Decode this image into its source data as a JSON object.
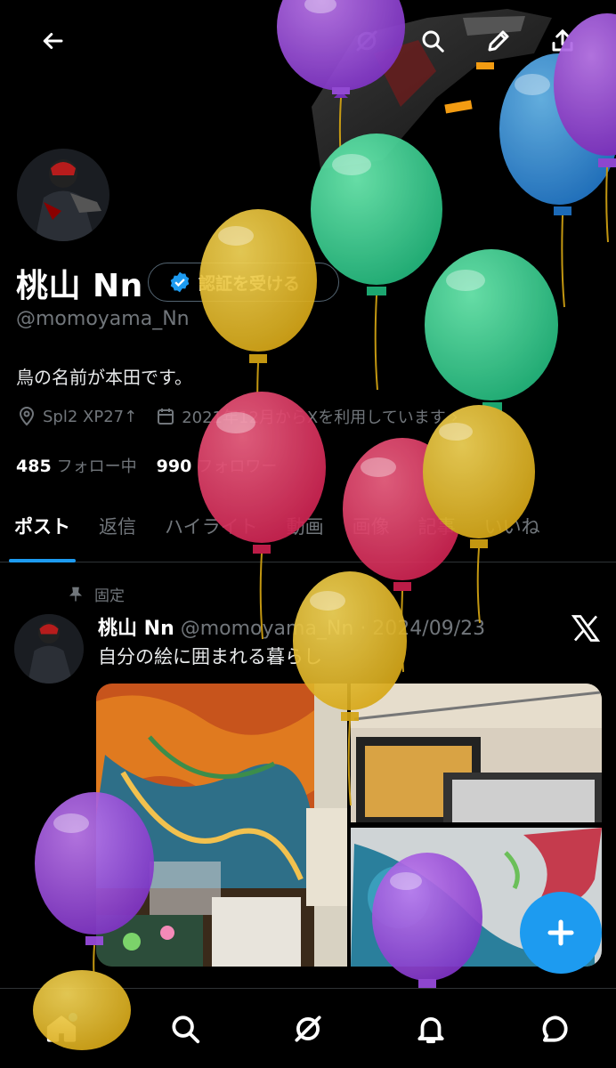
{
  "profile": {
    "name": "桃山 Nn",
    "verify_label": "認証を受ける",
    "handle": "@momoyama_Nn",
    "bio": "鳥の名前が本田です。",
    "location": "Spl2 XP27↑",
    "joined": "2021年12月からXを利用しています",
    "following_count": "485",
    "following_label": "フォロー中",
    "followers_count": "990",
    "followers_label": "フォロワー"
  },
  "tabs": [
    "ポスト",
    "返信",
    "ハイライト",
    "動画",
    "画像",
    "記事",
    "いいね"
  ],
  "post": {
    "pinned_label": "固定",
    "author_name": "桃山 Nn",
    "author_handle_date": "@momoyama_Nn · 2024/09/23",
    "text": "自分の絵に囲まれる暮らし"
  },
  "icons": {
    "back": "back-arrow-icon",
    "grok": "grok-icon",
    "search": "search-icon",
    "edit": "pen-icon",
    "share": "share-icon",
    "verified": "verified-badge-icon",
    "location": "location-pin-icon",
    "calendar": "calendar-icon",
    "pin": "pin-icon",
    "x_logo": "x-logo-icon",
    "compose": "plus-icon"
  },
  "bottom_nav": [
    "home-icon",
    "search-icon",
    "grok-icon",
    "bell-icon",
    "chat-icon"
  ],
  "colors": {
    "accent": "#1d9bf0",
    "background": "#000000",
    "muted_text": "#71767b"
  }
}
